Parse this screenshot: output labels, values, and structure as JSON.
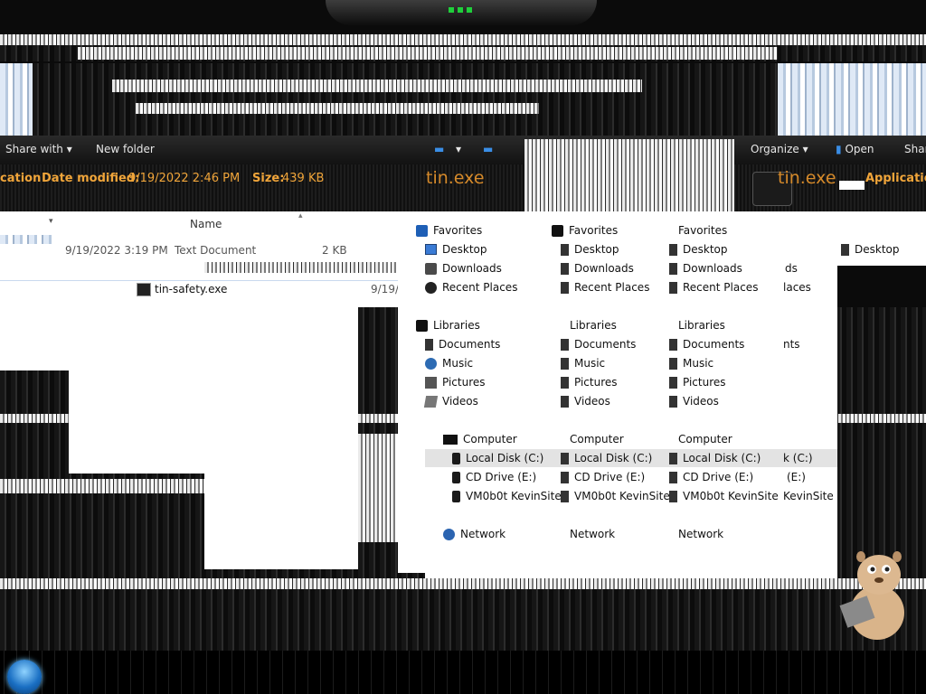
{
  "toolbar": {
    "share_with": "Share with",
    "new_folder": "New folder",
    "organize": "Organize",
    "open": "Open",
    "share_cut": "Shar"
  },
  "details": {
    "type_partial": "cation",
    "date_label": "Date modified:",
    "date_value": "9/19/2022 2:46 PM",
    "size_label": "Size:",
    "size_value": "439 KB",
    "filename_center": "tin.exe",
    "filename_right": "tin.exe",
    "type_right": "Application"
  },
  "filelist": {
    "column_name": "Name",
    "row1_date": "9/19/2022 3:19 PM",
    "row1_type": "Text Document",
    "row1_size": "2 KB",
    "row2_name": "tin-safety.exe",
    "row2_date": "9/19/"
  },
  "nav": {
    "favorites": "Favorites",
    "desktop": "Desktop",
    "downloads": "Downloads",
    "recent_places": "Recent Places",
    "libraries": "Libraries",
    "documents": "Documents",
    "music": "Music",
    "pictures": "Pictures",
    "videos": "Videos",
    "computer": "Computer",
    "local_disk": "Local Disk (C:)",
    "cd_drive": "CD Drive (E:)",
    "vm_site": "VM0b0t KevinSite",
    "network": "Network",
    "cut_downloads": "ds",
    "cut_recent": "laces",
    "cut_documents": "nts",
    "cut_local": "k (C:)",
    "cut_cd": "(E:)",
    "cut_vm": "KevinSite",
    "desktop_far": "Desktop"
  }
}
